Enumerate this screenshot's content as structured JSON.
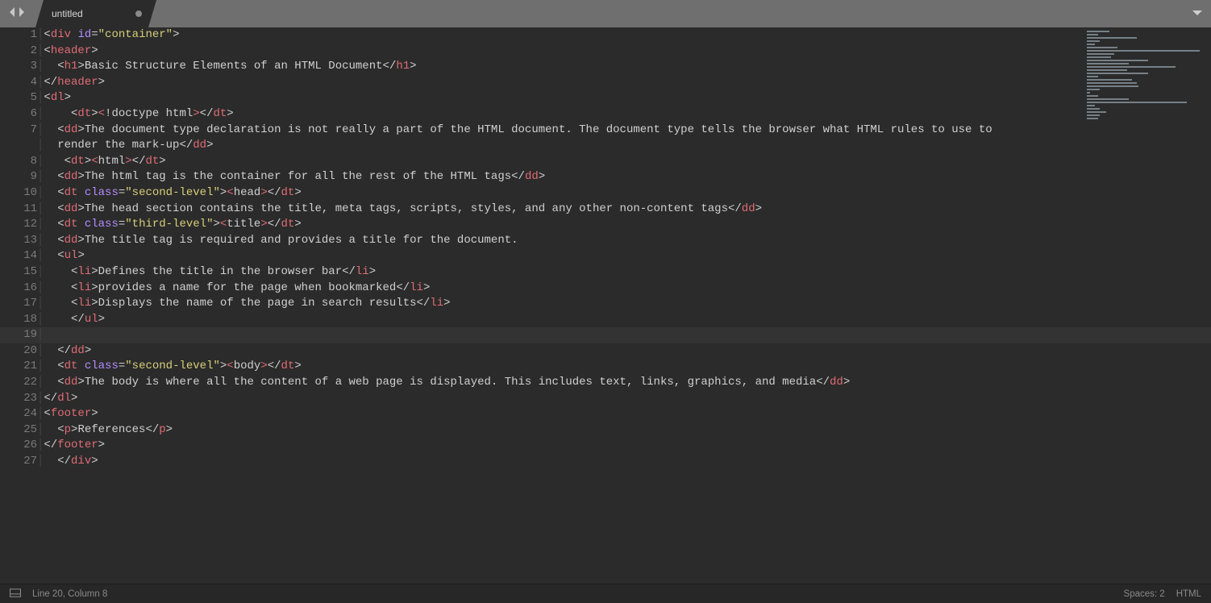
{
  "tab": {
    "title": "untitled",
    "dirty": true
  },
  "status": {
    "cursor": "Line 20, Column 8",
    "indent": "Spaces: 2",
    "syntax": "HTML"
  },
  "current_line_index": 19,
  "code_lines": [
    {
      "n": "1",
      "tokens": [
        [
          "pun",
          "<"
        ],
        [
          "tag",
          "div"
        ],
        [
          "txt",
          " "
        ],
        [
          "attr",
          "id"
        ],
        [
          "pun",
          "="
        ],
        [
          "str",
          "\"container\""
        ],
        [
          "pun",
          ">"
        ]
      ]
    },
    {
      "n": "2",
      "tokens": [
        [
          "pun",
          "<"
        ],
        [
          "tag",
          "header"
        ],
        [
          "pun",
          ">"
        ]
      ]
    },
    {
      "n": "3",
      "tokens": [
        [
          "txt",
          "  "
        ],
        [
          "pun",
          "<"
        ],
        [
          "tag",
          "h1"
        ],
        [
          "pun",
          ">"
        ],
        [
          "txt",
          "Basic Structure Elements of an HTML Document"
        ],
        [
          "pun",
          "</"
        ],
        [
          "tag",
          "h1"
        ],
        [
          "pun",
          ">"
        ]
      ]
    },
    {
      "n": "4",
      "tokens": [
        [
          "pun",
          "</"
        ],
        [
          "tag",
          "header"
        ],
        [
          "pun",
          ">"
        ]
      ]
    },
    {
      "n": "5",
      "tokens": [
        [
          "pun",
          "<"
        ],
        [
          "tag",
          "dl"
        ],
        [
          "pun",
          ">"
        ]
      ]
    },
    {
      "n": "6",
      "tokens": [
        [
          "txt",
          "    "
        ],
        [
          "pun",
          "<"
        ],
        [
          "tag",
          "dt"
        ],
        [
          "pun",
          ">"
        ],
        [
          "ent",
          "&lt;"
        ],
        [
          "txt",
          "!doctype html"
        ],
        [
          "ent",
          "&gt;"
        ],
        [
          "pun",
          "</"
        ],
        [
          "tag",
          "dt"
        ],
        [
          "pun",
          ">"
        ]
      ]
    },
    {
      "n": "7",
      "tokens": [
        [
          "txt",
          "  "
        ],
        [
          "pun",
          "<"
        ],
        [
          "tag",
          "dd"
        ],
        [
          "pun",
          ">"
        ],
        [
          "txt",
          "The document type declaration is not really a part of the HTML document. The document type tells the browser what HTML rules to use to"
        ]
      ]
    },
    {
      "n": "",
      "tokens": [
        [
          "txt",
          "  render the mark-up"
        ],
        [
          "pun",
          "</"
        ],
        [
          "tag",
          "dd"
        ],
        [
          "pun",
          ">"
        ]
      ]
    },
    {
      "n": "8",
      "tokens": [
        [
          "txt",
          "   "
        ],
        [
          "pun",
          "<"
        ],
        [
          "tag",
          "dt"
        ],
        [
          "pun",
          ">"
        ],
        [
          "ent",
          "&lt;"
        ],
        [
          "txt",
          "html"
        ],
        [
          "ent",
          "&gt;"
        ],
        [
          "pun",
          "</"
        ],
        [
          "tag",
          "dt"
        ],
        [
          "pun",
          ">"
        ]
      ]
    },
    {
      "n": "9",
      "tokens": [
        [
          "txt",
          "  "
        ],
        [
          "pun",
          "<"
        ],
        [
          "tag",
          "dd"
        ],
        [
          "pun",
          ">"
        ],
        [
          "txt",
          "The html tag is the container for all the rest of the HTML tags"
        ],
        [
          "pun",
          "</"
        ],
        [
          "tag",
          "dd"
        ],
        [
          "pun",
          ">"
        ]
      ]
    },
    {
      "n": "10",
      "tokens": [
        [
          "txt",
          "  "
        ],
        [
          "pun",
          "<"
        ],
        [
          "tag",
          "dt"
        ],
        [
          "txt",
          " "
        ],
        [
          "attr",
          "class"
        ],
        [
          "pun",
          "="
        ],
        [
          "str",
          "\"second-level\""
        ],
        [
          "pun",
          ">"
        ],
        [
          "ent",
          "&lt;"
        ],
        [
          "txt",
          "head"
        ],
        [
          "ent",
          "&gt;"
        ],
        [
          "pun",
          "</"
        ],
        [
          "tag",
          "dt"
        ],
        [
          "pun",
          ">"
        ]
      ]
    },
    {
      "n": "11",
      "tokens": [
        [
          "txt",
          "  "
        ],
        [
          "pun",
          "<"
        ],
        [
          "tag",
          "dd"
        ],
        [
          "pun",
          ">"
        ],
        [
          "txt",
          "The head section contains the title, meta tags, scripts, styles, and any other non-content tags"
        ],
        [
          "pun",
          "</"
        ],
        [
          "tag",
          "dd"
        ],
        [
          "pun",
          ">"
        ]
      ]
    },
    {
      "n": "12",
      "tokens": [
        [
          "txt",
          "  "
        ],
        [
          "pun",
          "<"
        ],
        [
          "tag",
          "dt"
        ],
        [
          "txt",
          " "
        ],
        [
          "attr",
          "class"
        ],
        [
          "pun",
          "="
        ],
        [
          "str",
          "\"third-level\""
        ],
        [
          "pun",
          ">"
        ],
        [
          "ent",
          "&lt;"
        ],
        [
          "txt",
          "title"
        ],
        [
          "ent",
          "&gt;"
        ],
        [
          "pun",
          "</"
        ],
        [
          "tag",
          "dt"
        ],
        [
          "pun",
          ">"
        ]
      ]
    },
    {
      "n": "13",
      "tokens": [
        [
          "txt",
          "  "
        ],
        [
          "pun",
          "<"
        ],
        [
          "tag",
          "dd"
        ],
        [
          "pun",
          ">"
        ],
        [
          "txt",
          "The title tag is required and provides a title for the document."
        ]
      ]
    },
    {
      "n": "14",
      "tokens": [
        [
          "txt",
          "  "
        ],
        [
          "pun",
          "<"
        ],
        [
          "tag",
          "ul"
        ],
        [
          "pun",
          ">"
        ]
      ]
    },
    {
      "n": "15",
      "tokens": [
        [
          "txt",
          "    "
        ],
        [
          "pun",
          "<"
        ],
        [
          "tag",
          "li"
        ],
        [
          "pun",
          ">"
        ],
        [
          "txt",
          "Defines the title in the browser bar"
        ],
        [
          "pun",
          "</"
        ],
        [
          "tag",
          "li"
        ],
        [
          "pun",
          ">"
        ]
      ]
    },
    {
      "n": "16",
      "tokens": [
        [
          "txt",
          "    "
        ],
        [
          "pun",
          "<"
        ],
        [
          "tag",
          "li"
        ],
        [
          "pun",
          ">"
        ],
        [
          "txt",
          "provides a name for the page when bookmarked"
        ],
        [
          "pun",
          "</"
        ],
        [
          "tag",
          "li"
        ],
        [
          "pun",
          ">"
        ]
      ]
    },
    {
      "n": "17",
      "tokens": [
        [
          "txt",
          "    "
        ],
        [
          "pun",
          "<"
        ],
        [
          "tag",
          "li"
        ],
        [
          "pun",
          ">"
        ],
        [
          "txt",
          "Displays the name of the page in search results"
        ],
        [
          "pun",
          "</"
        ],
        [
          "tag",
          "li"
        ],
        [
          "pun",
          ">"
        ]
      ]
    },
    {
      "n": "18",
      "tokens": [
        [
          "txt",
          "    "
        ],
        [
          "pun",
          "</"
        ],
        [
          "tag",
          "ul"
        ],
        [
          "pun",
          ">"
        ]
      ]
    },
    {
      "n": "19",
      "tokens": [
        [
          "txt",
          " "
        ]
      ]
    },
    {
      "n": "20",
      "tokens": [
        [
          "txt",
          "  "
        ],
        [
          "pun",
          "</"
        ],
        [
          "tag",
          "dd"
        ],
        [
          "pun",
          ">"
        ]
      ]
    },
    {
      "n": "21",
      "tokens": [
        [
          "txt",
          "  "
        ],
        [
          "pun",
          "<"
        ],
        [
          "tag",
          "dt"
        ],
        [
          "txt",
          " "
        ],
        [
          "attr",
          "class"
        ],
        [
          "pun",
          "="
        ],
        [
          "str",
          "\"second-level\""
        ],
        [
          "pun",
          ">"
        ],
        [
          "ent",
          "&lt;"
        ],
        [
          "txt",
          "body"
        ],
        [
          "ent",
          "&gt;"
        ],
        [
          "pun",
          "</"
        ],
        [
          "tag",
          "dt"
        ],
        [
          "pun",
          ">"
        ]
      ]
    },
    {
      "n": "22",
      "tokens": [
        [
          "txt",
          "  "
        ],
        [
          "pun",
          "<"
        ],
        [
          "tag",
          "dd"
        ],
        [
          "pun",
          ">"
        ],
        [
          "txt",
          "The body is where all the content of a web page is displayed. This includes text, links, graphics, and media"
        ],
        [
          "pun",
          "</"
        ],
        [
          "tag",
          "dd"
        ],
        [
          "pun",
          ">"
        ]
      ]
    },
    {
      "n": "23",
      "tokens": [
        [
          "pun",
          "</"
        ],
        [
          "tag",
          "dl"
        ],
        [
          "pun",
          ">"
        ]
      ]
    },
    {
      "n": "24",
      "tokens": [
        [
          "pun",
          "<"
        ],
        [
          "tag",
          "footer"
        ],
        [
          "pun",
          ">"
        ]
      ]
    },
    {
      "n": "25",
      "tokens": [
        [
          "txt",
          "  "
        ],
        [
          "pun",
          "<"
        ],
        [
          "tag",
          "p"
        ],
        [
          "pun",
          ">"
        ],
        [
          "txt",
          "References"
        ],
        [
          "pun",
          "</"
        ],
        [
          "tag",
          "p"
        ],
        [
          "pun",
          ">"
        ]
      ]
    },
    {
      "n": "26",
      "tokens": [
        [
          "pun",
          "</"
        ],
        [
          "tag",
          "footer"
        ],
        [
          "pun",
          ">"
        ]
      ]
    },
    {
      "n": "27",
      "tokens": [
        [
          "txt",
          "  "
        ],
        [
          "pun",
          "</"
        ],
        [
          "tag",
          "div"
        ],
        [
          "pun",
          ">"
        ]
      ]
    }
  ],
  "minimap_widths": [
    28,
    14,
    62,
    16,
    10,
    38,
    140,
    34,
    30,
    76,
    52,
    110,
    50,
    76,
    14,
    56,
    62,
    64,
    16,
    4,
    14,
    52,
    124,
    10,
    16,
    24,
    16,
    14
  ]
}
